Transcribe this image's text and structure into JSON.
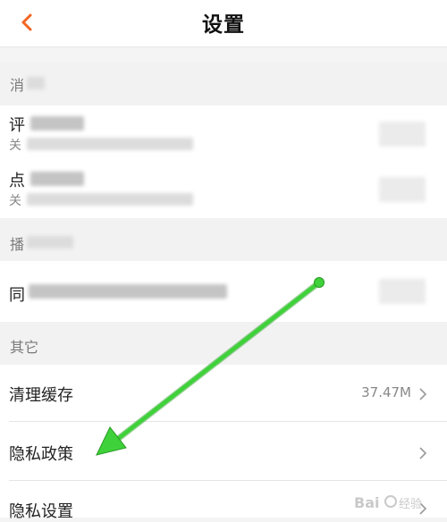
{
  "header": {
    "title": "设置",
    "back_icon": "chevron-left-icon"
  },
  "sections": {
    "messages": {
      "label": "消",
      "items": [
        {
          "title": "评",
          "sub": "关"
        },
        {
          "title": "点",
          "sub": "关"
        }
      ]
    },
    "playback": {
      "label": "播",
      "items": [
        {
          "title": "同"
        }
      ]
    },
    "other": {
      "label": "其它",
      "items": [
        {
          "title": "清理缓存",
          "value": "37.47M",
          "icon": "chevron-right-icon"
        },
        {
          "title": "隐私政策",
          "icon": "chevron-right-icon"
        },
        {
          "title": "隐私设置",
          "icon": "chevron-right-icon"
        }
      ]
    }
  },
  "annotation": {
    "color": "#3fd13a",
    "icon": "arrow-icon"
  },
  "watermark": {
    "text": "Bai du"
  },
  "colors": {
    "accent": "#f26522",
    "background": "#f4f4f4"
  }
}
